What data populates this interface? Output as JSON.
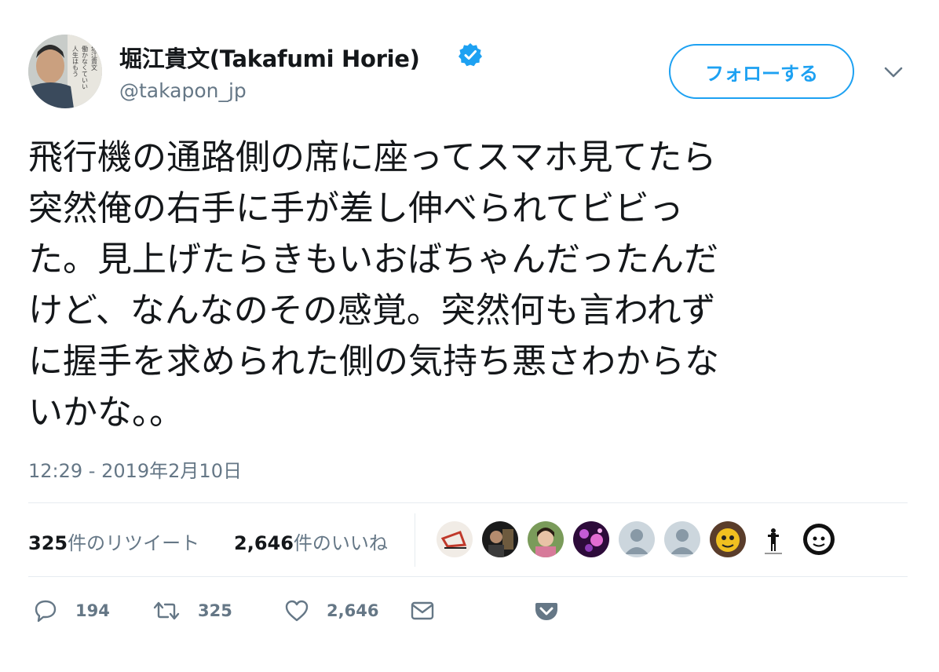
{
  "user": {
    "display_name": "堀江貴文(Takafumi Horie)",
    "handle": "@takapon_jp",
    "avatar_book_text": "人生はもう働かなくていい 堀江貴文"
  },
  "follow_button": {
    "label": "フォローする"
  },
  "tweet": {
    "lines": [
      "飛行機の通路側の席に座ってスマホ見てたら",
      "突然俺の右手に手が差し伸べられてビビっ",
      "た。見上げたらきもいおばちゃんだったんだ",
      "けど、なんなのその感覚。突然何も言われず",
      "に握手を求められた側の気持ち悪さわからな",
      "いかな。。"
    ],
    "timestamp": "12:29 - 2019年2月10日"
  },
  "stats": {
    "retweets_count": "325",
    "retweets_label": "件のリツイート",
    "likes_count": "2,646",
    "likes_label": "件のいいね"
  },
  "actions": {
    "reply_count": "194",
    "retweet_count": "325",
    "like_count": "2,646"
  },
  "icons": {
    "verified": "verified-badge-icon",
    "caret": "chevron-down-icon",
    "reply": "reply-icon",
    "retweet": "retweet-icon",
    "like": "heart-icon",
    "dm": "envelope-icon",
    "pocket": "pocket-icon"
  },
  "colors": {
    "accent": "#1da1f2",
    "text": "#14171a",
    "secondary": "#657786",
    "divider": "#e6ecf0"
  }
}
